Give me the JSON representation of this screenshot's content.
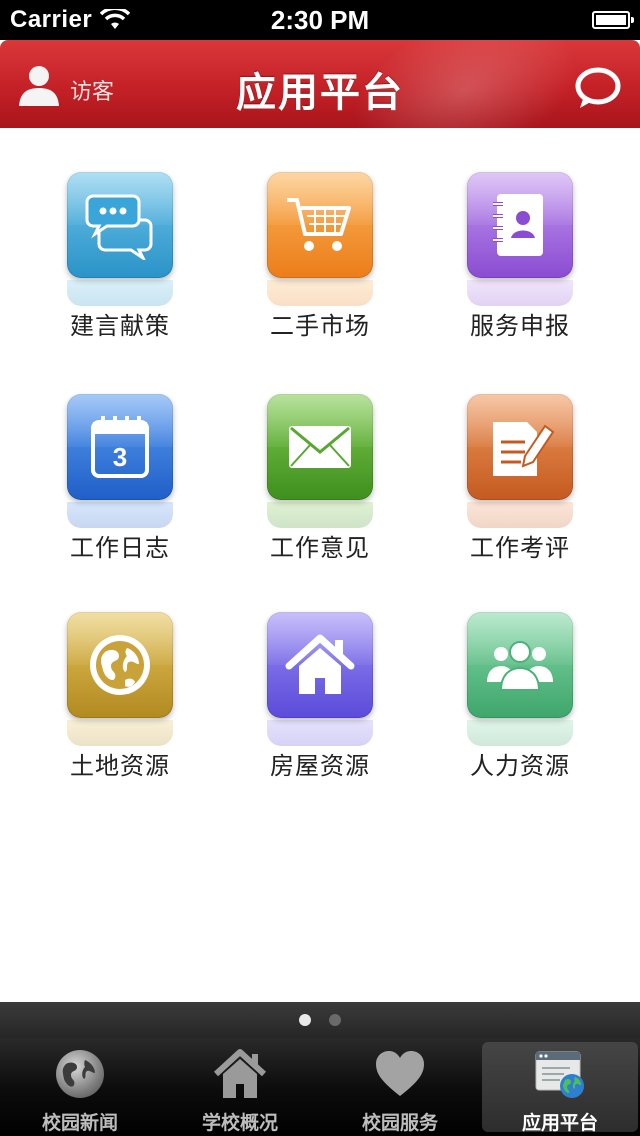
{
  "status_bar": {
    "carrier": "Carrier",
    "time": "2:30 PM"
  },
  "header": {
    "user_label": "访客",
    "title": "应用平台"
  },
  "apps": [
    {
      "label": "建言献策",
      "icon": "chat-bubbles-icon",
      "color": "#2a93c8"
    },
    {
      "label": "二手市场",
      "icon": "shopping-cart-icon",
      "color": "#ec7d1a"
    },
    {
      "label": "服务申报",
      "icon": "address-book-icon",
      "color": "#8a4cd2"
    },
    {
      "label": "工作日志",
      "icon": "calendar-icon",
      "day": "3",
      "color": "#1f5fc7"
    },
    {
      "label": "工作意见",
      "icon": "envelope-icon",
      "color": "#3f8f1f"
    },
    {
      "label": "工作考评",
      "icon": "document-edit-icon",
      "color": "#c45a1f"
    },
    {
      "label": "土地资源",
      "icon": "globe-icon",
      "color": "#b18a20"
    },
    {
      "label": "房屋资源",
      "icon": "house-icon",
      "color": "#5b4bd9"
    },
    {
      "label": "人力资源",
      "icon": "people-icon",
      "color": "#3ea66b"
    }
  ],
  "pager": {
    "pages": 2,
    "current": 1
  },
  "tabs": [
    {
      "label": "校园新闻",
      "icon": "globe-icon",
      "active": false
    },
    {
      "label": "学校概况",
      "icon": "house-icon",
      "active": false
    },
    {
      "label": "校园服务",
      "icon": "heart-icon",
      "active": false
    },
    {
      "label": "应用平台",
      "icon": "app-window-icon",
      "active": true
    }
  ],
  "colors": {
    "header_red": "#c42127",
    "tab_bar": "#0d0d0d",
    "background": "#ffffff"
  }
}
